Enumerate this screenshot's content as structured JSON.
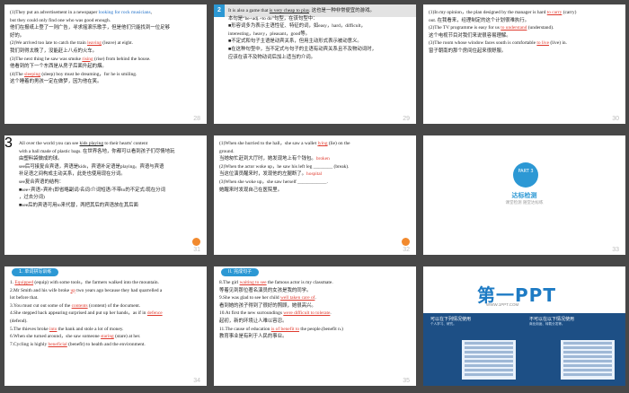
{
  "slides": [
    {
      "page": "28",
      "lines": [
        [
          "(1)They put an advertisement in a newspaper ",
          {
            "blue": "looking for rock musicians"
          },
          ","
        ],
        [
          "but they could only find one who was good enough."
        ],
        [
          "他们在报纸上登了一则广告，寻求摇滚乐歌手，但是他们只能找到一位足够"
        ],
        [
          "好的。"
        ],
        [
          "(2)We arrived too late to catch the train ",
          {
            "ans": "leaving"
          },
          " (leave) at eight."
        ],
        [
          "我们到得太晚了，没能赶上八点的火车。"
        ],
        [
          "(3)The next thing he saw was smoke ",
          {
            "ans": "rising"
          },
          " (rise) from behind the house."
        ],
        [
          "他看到的下一个东西是从房子后面升起的烟。"
        ],
        [
          "(4)The ",
          {
            "ans": "sleeping"
          },
          " (sleep) boy must be dreaming，for he is smiling."
        ],
        [
          "这个睡着的男孩一定在做梦，因为他在笑。"
        ]
      ]
    },
    {
      "page": "29",
      "tag": "2",
      "lines": [
        [
          "It is also a game that ",
          {
            "ul": "is very cheap to play"
          },
          ". 这也是一种非常便宜的游戏。"
        ],
        [
          "本句是“be+adj.+to do”句型，在该句型中："
        ],
        [
          "■形容词多为表示主语性征、特征的词，如easy，hard，difficult，"
        ],
        [
          "interesting，heavy，pleasant，good等。"
        ],
        [
          "■不定式和句子主语是动宾关系，但用主动形式表示被动意义。"
        ],
        [
          "■在这种句型中，当不定式与句子的主语有动宾关系且不及物动词时，"
        ],
        [
          "应该在该不及物动词后加上适当的介词。"
        ]
      ]
    },
    {
      "page": "30",
      "lines": [
        [
          "(1)In my opinion，the plan designed by the manager is hard ",
          {
            "ans": "to carry"
          },
          " (carry)"
        ],
        [
          "out. 在我看来，经理制定的这个计划很难执行。"
        ],
        [
          "(2)The TV programme is easy for us ",
          {
            "ans": "to understand"
          },
          " (understand)."
        ],
        [
          "这个电视节目对我们来说很容易理解。"
        ],
        [
          "(3)The room whose window faces south is comfortable ",
          {
            "ans": "to live"
          },
          " (live) in."
        ],
        [
          "窗子朝南的那个房间住起来很舒服。"
        ]
      ]
    },
    {
      "page": "31",
      "tag": "3",
      "lines": [
        [
          "All over the world you can see ",
          {
            "ul": "kids playing"
          },
          " to their hearts' content"
        ],
        [
          "with a ball made of plastic bags. 在世界各地，你都可以看到孩子们尽情地玩"
        ],
        [
          "由塑料袋做成的球。"
        ],
        [
          "see后可接复合宾语，宾语是kids，宾语补足语是playing。宾语与宾语"
        ],
        [
          "补足语之间构成主动关系，此处也使用现在分词。"
        ],
        [
          "see复合宾语的结构："
        ],
        [
          "■see+宾语+宾补(即省略副词/名词/介词短语/不带to的不定式/现在分词"
        ],
        [
          "，过去分词)"
        ],
        [
          "■see后的宾语可用to来代替，两把其后的宾语放在其后面"
        ]
      ]
    },
    {
      "page": "32",
      "lines": [
        [
          "(1)When she hurried to the hall，she saw a wallet ",
          {
            "ans": "lying"
          },
          " (lie) on the"
        ],
        [
          "ground."
        ],
        [
          "当她匆忙赶到大厅时，她发现地上有个钱包。",
          {
            "red": "broken"
          }
        ],
        [
          "(2)When the actor woke up，he saw his left leg ________ (break)."
        ],
        [
          "当这位演员醒来时，发现他的左腿断了。",
          {
            "red": "hospital"
          }
        ],
        [
          "(3)When she woke up，she saw herself ____________."
        ],
        [
          "她醒来时发现自己在医院里。"
        ]
      ]
    },
    {
      "page": "33",
      "part_label": "PART 3",
      "title": "达标检测",
      "subtitle": "课堂检测   随堂达标练"
    },
    {
      "page": "34",
      "header": "1. 单词拼写训练",
      "lines": [
        [
          "1. ",
          {
            "ans": "Equipped"
          },
          " (equip) with some tools，the farmers walked into the mountain."
        ],
        [
          "2.Mr Smith and his wife broke ",
          {
            "ans": "up"
          },
          " two years ago because they had quarrelled a"
        ],
        [
          "lot before that."
        ],
        [
          "3.You must cut out some of the ",
          {
            "ans": "contents"
          },
          " (content) of the document."
        ],
        [
          "4.She stepped back appearing surprised and put up her hands，as if in ",
          {
            "ans": "defence"
          }
        ],
        [
          "(defend)."
        ],
        [
          "5.The thieves broke ",
          {
            "ans": "into"
          },
          " the bank and stole a lot of money."
        ],
        [
          "6.When she turned around，she saw someone ",
          {
            "ans": "staring"
          },
          " (stare) at her."
        ],
        [
          "7.Cycling is highly ",
          {
            "ans": "beneficial"
          },
          " (benefit) to health and the environment."
        ]
      ]
    },
    {
      "page": "35",
      "header": "II. 完成句子",
      "lines": [
        [
          "8.The girl ",
          {
            "ans": "waiting to see"
          },
          " the famous actor is my classmate."
        ],
        [
          "等着见到那位著名演员的女孩是我的同学。"
        ],
        [
          "9.She was glad to see her child ",
          {
            "ans": "well taken care of"
          },
          "."
        ],
        [
          "看到她的孩子得到了很好的照顾，她很高兴。"
        ],
        [
          "10.At first the new surroundings ",
          {
            "ans": "were difficult to tolerate"
          },
          "."
        ],
        [
          "起初，新的环境让人难以容忍。"
        ],
        [
          "11.The cause of education ",
          {
            "ans": "is of benefit to"
          },
          " the people.(benefit n.)"
        ],
        [
          "教育事业是有利于人民的事业。"
        ]
      ]
    },
    {
      "page": "",
      "logo": "第一PPT",
      "url": "WWW.1PPT.COM",
      "left_title": "可以在下列情况使用",
      "left_sub": "个人学习、研究。",
      "right_title": "不可以在以下情况使用",
      "right_sub": "商业用途、转载分发等。"
    }
  ]
}
